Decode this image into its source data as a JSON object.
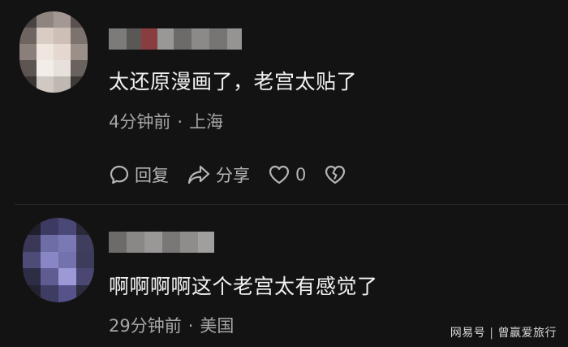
{
  "comments": [
    {
      "text": "太还原漫画了，老宫太贴了",
      "time": "4分钟前",
      "separator": "·",
      "location": "上海",
      "actions": {
        "reply": "回复",
        "share": "分享",
        "like_count": "0"
      }
    },
    {
      "text": "啊啊啊啊这个老宫太有感觉了",
      "time": "29分钟前",
      "separator": "·",
      "location": "美国"
    }
  ],
  "watermark": {
    "brand": "网易号",
    "divider": "|",
    "author": "曾赢爱旅行"
  },
  "icons": [
    "comment-icon",
    "share-icon",
    "heart-icon",
    "broken-heart-icon"
  ],
  "colors": {
    "background": "#141313",
    "text": "#f2f2f2",
    "meta": "#a6a6a6",
    "action": "#b5b5b5"
  }
}
